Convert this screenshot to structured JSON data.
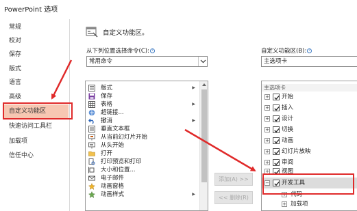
{
  "window": {
    "title": "PowerPoint 选项"
  },
  "left_nav": {
    "items": [
      {
        "label": "常规",
        "selected": false
      },
      {
        "label": "校对",
        "selected": false
      },
      {
        "label": "保存",
        "selected": false
      },
      {
        "label": "版式",
        "selected": false
      },
      {
        "label": "语言",
        "selected": false
      },
      {
        "label": "高级",
        "selected": false
      },
      {
        "label": "自定义功能区",
        "selected": true
      },
      {
        "label": "快速访问工具栏",
        "selected": false
      },
      {
        "label": "加载项",
        "selected": false
      },
      {
        "label": "信任中心",
        "selected": false
      }
    ]
  },
  "panel": {
    "title": "自定义功能区。"
  },
  "commands": {
    "label": "从下列位置选择命令(C):",
    "dropdown_value": "常用命令",
    "items": [
      {
        "label": "版式",
        "icon": "layout-icon",
        "submenu": true
      },
      {
        "label": "保存",
        "icon": "save-icon",
        "submenu": false
      },
      {
        "label": "表格",
        "icon": "table-icon",
        "submenu": true
      },
      {
        "label": "超链接...",
        "icon": "hyperlink-icon",
        "submenu": false
      },
      {
        "label": "撤消",
        "icon": "undo-icon",
        "submenu": true
      },
      {
        "label": "垂直文本框",
        "icon": "vertical-textbox-icon",
        "submenu": false
      },
      {
        "label": "从当前幻灯片开始",
        "icon": "present-current-icon",
        "submenu": false
      },
      {
        "label": "从头开始",
        "icon": "present-start-icon",
        "submenu": false
      },
      {
        "label": "打开",
        "icon": "open-folder-icon",
        "submenu": false
      },
      {
        "label": "打印预览和打印",
        "icon": "print-preview-icon",
        "submenu": false
      },
      {
        "label": "大小和位置...",
        "icon": "size-position-icon",
        "submenu": false
      },
      {
        "label": "电子邮件",
        "icon": "email-icon",
        "submenu": false
      },
      {
        "label": "动画窗格",
        "icon": "animation-pane-icon",
        "submenu": false
      },
      {
        "label": "动画样式",
        "icon": "animation-styles-icon",
        "submenu": true
      }
    ]
  },
  "buttons": {
    "add": "添加(A) >>",
    "remove": "<< 删除(R)"
  },
  "ribbon": {
    "label": "自定义功能区(B):",
    "dropdown_value": "主选项卡",
    "tree_header": "主选项卡",
    "tabs": [
      {
        "label": "开始",
        "expander": "+",
        "checked": true,
        "selected": false,
        "child": false
      },
      {
        "label": "插入",
        "expander": "+",
        "checked": true,
        "selected": false,
        "child": false
      },
      {
        "label": "设计",
        "expander": "+",
        "checked": true,
        "selected": false,
        "child": false
      },
      {
        "label": "切换",
        "expander": "+",
        "checked": true,
        "selected": false,
        "child": false
      },
      {
        "label": "动画",
        "expander": "+",
        "checked": true,
        "selected": false,
        "child": false
      },
      {
        "label": "幻灯片放映",
        "expander": "+",
        "checked": true,
        "selected": false,
        "child": false
      },
      {
        "label": "审阅",
        "expander": "+",
        "checked": true,
        "selected": false,
        "child": false
      },
      {
        "label": "视图",
        "expander": "+",
        "checked": true,
        "selected": false,
        "child": false
      },
      {
        "label": "开发工具",
        "expander": "−",
        "checked": true,
        "selected": true,
        "child": false
      },
      {
        "label": "代码",
        "expander": "+",
        "checked": false,
        "selected": false,
        "child": true
      },
      {
        "label": "加载项",
        "expander": "+",
        "checked": false,
        "selected": false,
        "child": true
      }
    ]
  },
  "colors": {
    "highlight": "#f7c7b2",
    "annotation": "#e02a2a",
    "info": "#3a78c2"
  }
}
